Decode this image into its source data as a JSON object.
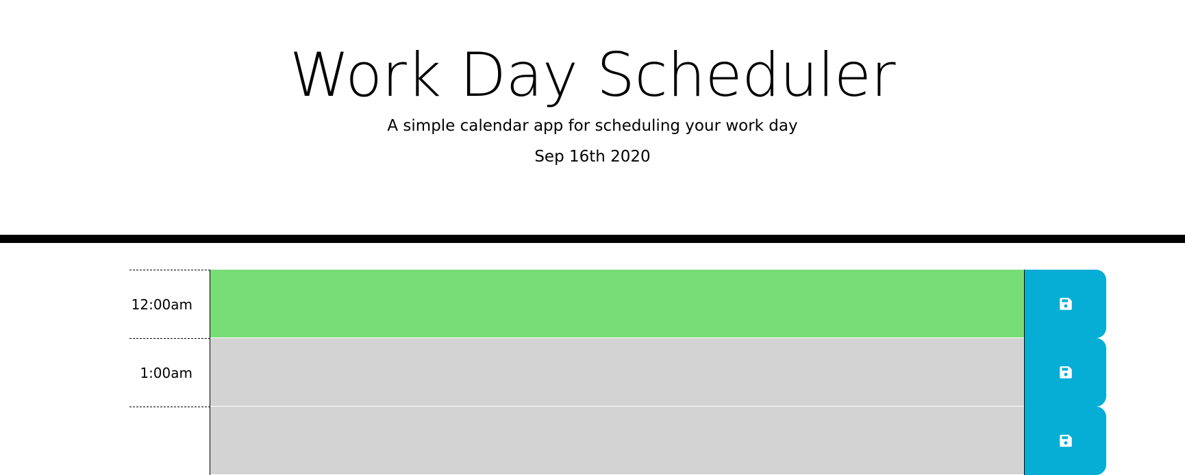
{
  "header": {
    "title": "Work Day Scheduler",
    "subtitle": "A simple calendar app for scheduling your work day",
    "date": "Sep 16th 2020"
  },
  "rows": [
    {
      "hour": "12:00am",
      "task": "",
      "state": "present"
    },
    {
      "hour": "1:00am",
      "task": "",
      "state": "past"
    },
    {
      "hour": "",
      "task": "",
      "state": "past"
    }
  ],
  "colors": {
    "present": "#77dd77",
    "past": "#d3d3d3",
    "save_button": "#06aed5",
    "divider": "#000000"
  },
  "icons": {
    "save": "floppy-disk-icon"
  }
}
